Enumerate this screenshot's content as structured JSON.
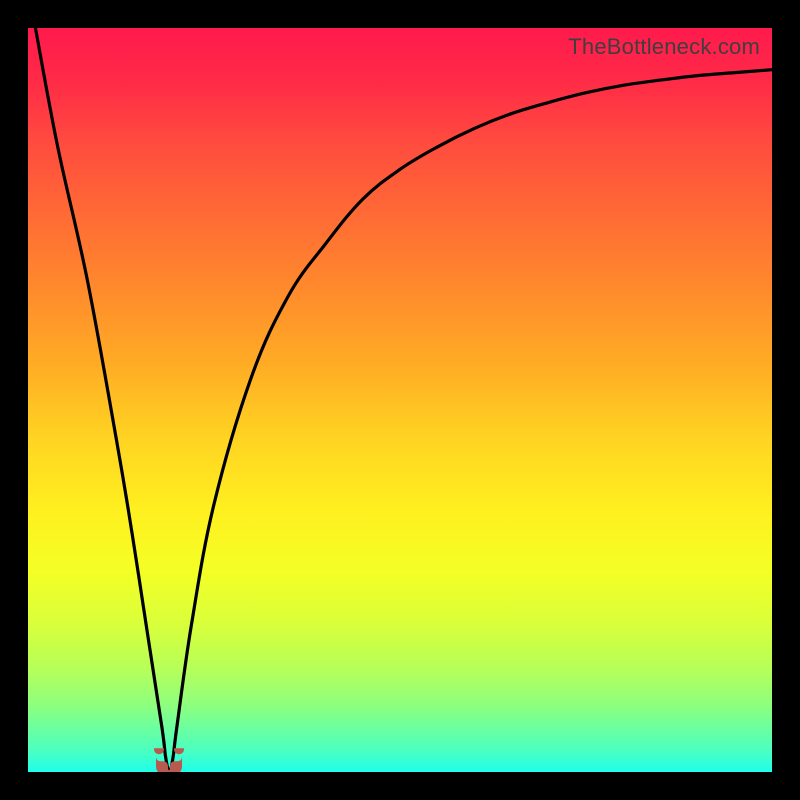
{
  "watermark": "TheBottleneck.com",
  "colors": {
    "frame": "#000000",
    "curve": "#000000",
    "marker": "#b85a50",
    "gradient_top": "#ff1a4d",
    "gradient_bottom": "#1effea"
  },
  "chart_data": {
    "type": "line",
    "title": "",
    "xlabel": "",
    "ylabel": "",
    "xlim": [
      0,
      100
    ],
    "ylim": [
      0,
      100
    ],
    "grid": false,
    "legend": false,
    "annotations": [
      "U-shaped marker at curve minimum"
    ],
    "background": "vertical rainbow gradient (red top → green bottom)",
    "series": [
      {
        "name": "bottleneck-curve",
        "x": [
          1,
          4,
          8,
          12,
          14,
          16,
          18,
          18.5,
          19,
          19.5,
          20,
          22,
          25,
          30,
          35,
          40,
          45,
          50,
          55,
          60,
          65,
          70,
          75,
          80,
          85,
          90,
          95,
          100
        ],
        "values": [
          100,
          84,
          66,
          44,
          32,
          19,
          6,
          2,
          0,
          2,
          6,
          20,
          36,
          53,
          64,
          71,
          77,
          81,
          84,
          86.5,
          88.5,
          90,
          91.3,
          92.3,
          93,
          93.6,
          94,
          94.4
        ]
      }
    ],
    "minimum": {
      "x": 19,
      "y": 0
    }
  }
}
